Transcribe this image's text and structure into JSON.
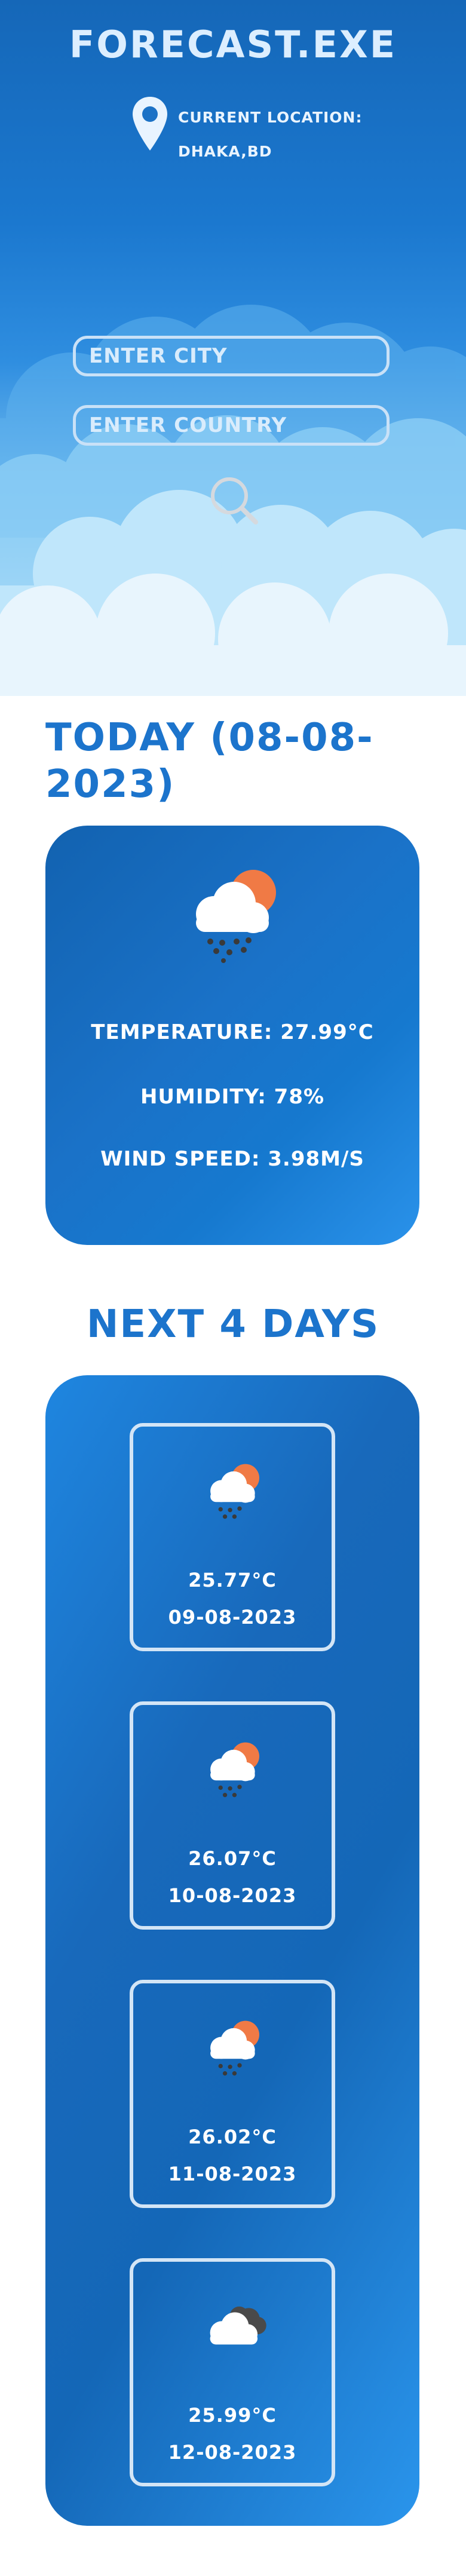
{
  "app": {
    "title": "FORECAST.EXE"
  },
  "location": {
    "label": "CURRENT LOCATION:",
    "value": "DHAKA,BD"
  },
  "search": {
    "city_placeholder": "ENTER CITY",
    "country_placeholder": "ENTER COUNTRY"
  },
  "today": {
    "heading": "TODAY (08-08-2023)",
    "icon": "cloud-sun-rain-icon",
    "temperature": "TEMPERATURE: 27.99°C",
    "humidity": "HUMIDITY: 78%",
    "wind": "WIND SPEED: 3.98M/S"
  },
  "forecast": {
    "heading": "NEXT 4 DAYS",
    "days": [
      {
        "temp": "25.77°C",
        "date": "09-08-2023",
        "icon": "cloud-sun-rain-icon"
      },
      {
        "temp": "26.07°C",
        "date": "10-08-2023",
        "icon": "cloud-sun-rain-icon"
      },
      {
        "temp": "26.02°C",
        "date": "11-08-2023",
        "icon": "cloud-sun-rain-icon"
      },
      {
        "temp": "25.99°C",
        "date": "12-08-2023",
        "icon": "cloudy-icon"
      }
    ]
  },
  "colors": {
    "accent": "#1c74cc",
    "card_blue": "#1668b8",
    "sun": "#f07a45",
    "text_light": "#ffffff"
  }
}
